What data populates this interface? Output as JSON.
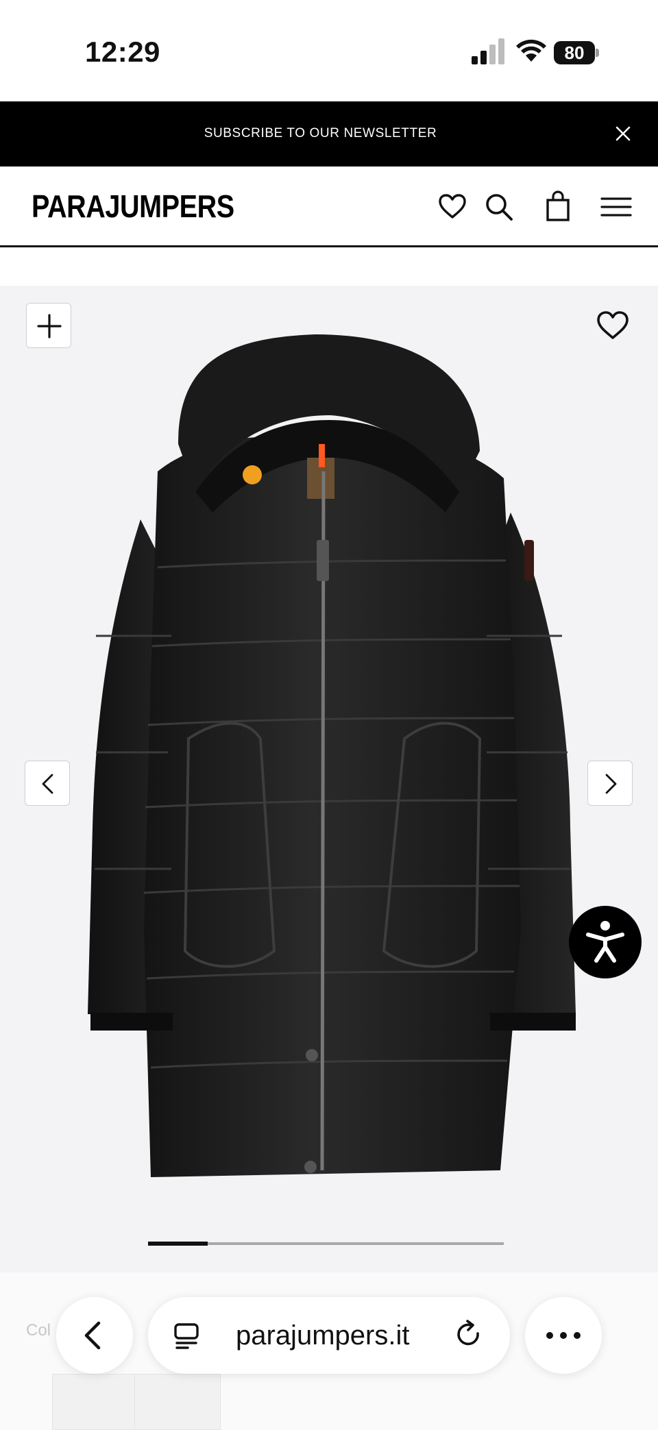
{
  "status_bar": {
    "time": "12:29",
    "battery_level": "80",
    "signal_bars_active": 2,
    "signal_bars_total": 4
  },
  "newsletter": {
    "text": "SUBSCRIBE TO OUR NEWSLETTER",
    "close_icon": "close-icon",
    "background": "#000000",
    "text_color": "#ffffff"
  },
  "header": {
    "brand": "PARAJUMPERS",
    "icons": [
      "heart-icon",
      "search-icon",
      "bag-icon",
      "menu-icon"
    ]
  },
  "gallery": {
    "zoom_icon": "plus-icon",
    "wishlist_icon": "heart-icon",
    "prev_icon": "chevron-left-icon",
    "next_icon": "chevron-right-icon",
    "image_alt": "Black hooded long down parka",
    "background": "#f3f3f6",
    "progress_fraction": 0.167
  },
  "accessibility": {
    "icon": "accessibility-icon"
  },
  "below_gallery": {
    "colour_label": "Col"
  },
  "browser": {
    "url": "parajumpers.it",
    "back_icon": "chevron-left-icon",
    "tabs_icon": "tabs-icon",
    "reload_icon": "reload-icon",
    "more_icon": "more-icon"
  }
}
